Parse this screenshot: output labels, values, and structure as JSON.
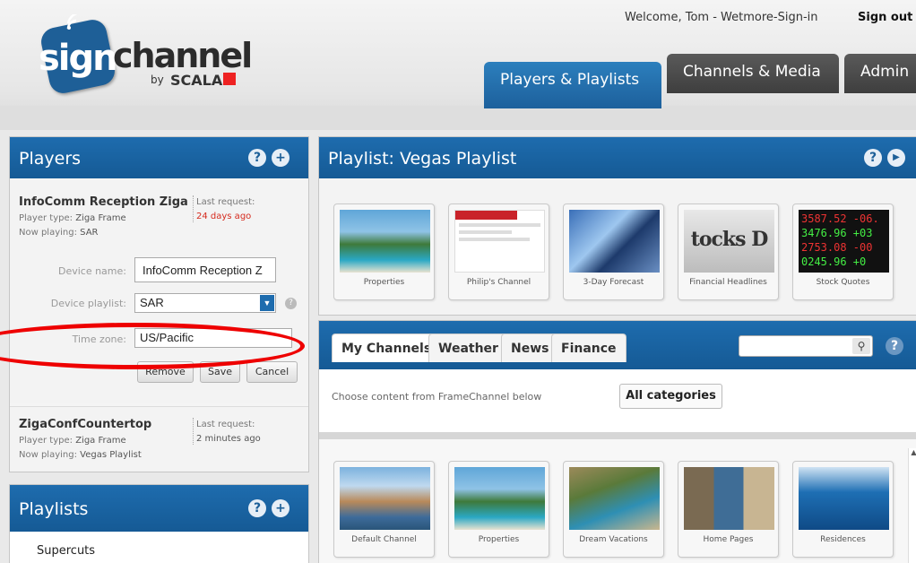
{
  "header": {
    "welcome": "Welcome, Tom - Wetmore-Sign-in",
    "signout": "Sign out",
    "tabs": [
      "Players & Playlists",
      "Channels & Media",
      "Admin"
    ]
  },
  "logo": {
    "sign": "sign",
    "channel": "channel",
    "by": "by",
    "scala": "SCALA"
  },
  "players": {
    "title": "Players",
    "help_icon": "?",
    "add_icon": "+",
    "cards": [
      {
        "name": "InfoComm Reception Ziga",
        "type_label": "Player type:",
        "type": "Ziga Frame",
        "playing_label": "Now playing:",
        "playing": "SAR",
        "last_label": "Last request:",
        "last": "24 days ago"
      },
      {
        "name": "ZigaConfCountertop",
        "type_label": "Player type:",
        "type": "Ziga Frame",
        "playing_label": "Now playing:",
        "playing": "Vegas Playlist",
        "last_label": "Last request:",
        "last": "2 minutes ago"
      }
    ],
    "form": {
      "device_name_label": "Device name:",
      "device_name": "InfoComm Reception Z",
      "device_playlist_label": "Device playlist:",
      "device_playlist": "SAR",
      "time_zone_label": "Time zone:",
      "time_zone": "US/Pacific",
      "remove": "Remove",
      "save": "Save",
      "cancel": "Cancel"
    }
  },
  "playlists": {
    "title": "Playlists",
    "items": [
      "Supercuts"
    ]
  },
  "playlist": {
    "title": "Playlist: Vegas Playlist",
    "items": [
      "Properties",
      "Philip's Channel",
      "3-Day Forecast",
      "Financial Headlines",
      "Stock Quotes"
    ]
  },
  "content": {
    "tabs": [
      "My Channels",
      "Weather",
      "News",
      "Finance"
    ],
    "choose_text": "Choose content from FrameChannel below",
    "category_button": "All categories",
    "items": [
      "Default Channel",
      "Properties",
      "Dream Vacations",
      "Home Pages",
      "Residences"
    ]
  },
  "colors": {
    "accent_blue": "#1e6cae",
    "dark_tab": "#4a4a4a",
    "alert_red": "#d52b1e"
  }
}
